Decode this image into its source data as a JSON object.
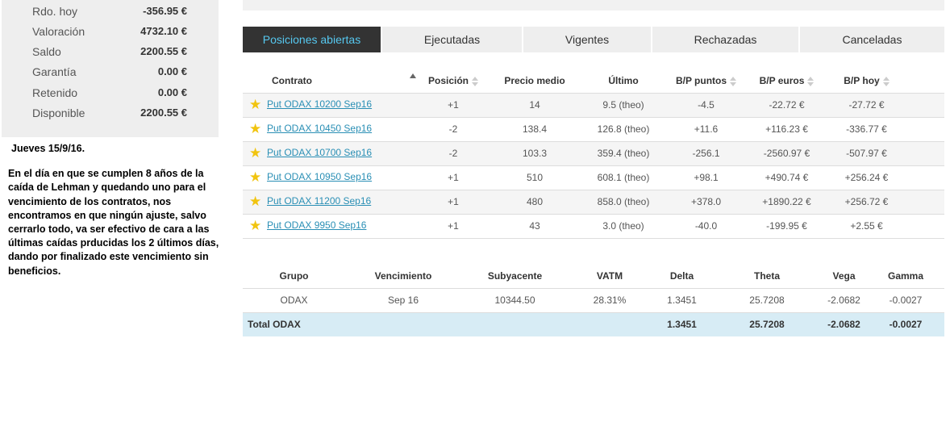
{
  "account": {
    "rows": [
      {
        "label": "Rdo. hoy",
        "value": "-356.95 €"
      },
      {
        "label": "Valoración",
        "value": "4732.10 €"
      },
      {
        "label": "Saldo",
        "value": "2200.55 €"
      },
      {
        "label": "Garantía",
        "value": "0.00 €"
      },
      {
        "label": "Retenido",
        "value": "0.00 €"
      },
      {
        "label": "Disponible",
        "value": "2200.55 €"
      }
    ]
  },
  "note": {
    "date": "Jueves 15/9/16.",
    "body": "En el día en que se cumplen 8 años de la caída de Lehman y quedando uno para el vencimiento de los contratos, nos encontramos en que ningún ajuste, salvo cerrarlo todo, va  ser efectivo de cara a las últimas caídas prducidas los 2 últimos días, dando por finalizado este vencimiento sin beneficios."
  },
  "tabs": [
    {
      "label": "Posiciones abiertas",
      "active": true
    },
    {
      "label": "Ejecutadas",
      "active": false
    },
    {
      "label": "Vigentes",
      "active": false
    },
    {
      "label": "Rechazadas",
      "active": false
    },
    {
      "label": "Canceladas",
      "active": false
    }
  ],
  "positions": {
    "headers": {
      "contract": "Contrato",
      "position": "Posición",
      "avg_price": "Precio medio",
      "last": "Último",
      "pl_points": "B/P puntos",
      "pl_euros": "B/P euros",
      "pl_today": "B/P hoy"
    },
    "rows": [
      {
        "contract": "Put ODAX 10200 Sep16",
        "position": "+1",
        "avg_price": "14",
        "last": "9.5 (theo)",
        "pl_points": "-4.5",
        "pl_euros": "-22.72 €",
        "pl_today": "-27.72 €"
      },
      {
        "contract": "Put ODAX 10450 Sep16",
        "position": "-2",
        "avg_price": "138.4",
        "last": "126.8 (theo)",
        "pl_points": "+11.6",
        "pl_euros": "+116.23 €",
        "pl_today": "-336.77 €"
      },
      {
        "contract": "Put ODAX 10700 Sep16",
        "position": "-2",
        "avg_price": "103.3",
        "last": "359.4 (theo)",
        "pl_points": "-256.1",
        "pl_euros": "-2560.97 €",
        "pl_today": "-507.97 €"
      },
      {
        "contract": "Put ODAX 10950 Sep16",
        "position": "+1",
        "avg_price": "510",
        "last": "608.1 (theo)",
        "pl_points": "+98.1",
        "pl_euros": "+490.74 €",
        "pl_today": "+256.24 €"
      },
      {
        "contract": "Put ODAX 11200 Sep16",
        "position": "+1",
        "avg_price": "480",
        "last": "858.0 (theo)",
        "pl_points": "+378.0",
        "pl_euros": "+1890.22 €",
        "pl_today": "+256.72 €"
      },
      {
        "contract": "Put ODAX 9950 Sep16",
        "position": "+1",
        "avg_price": "43",
        "last": "3.0 (theo)",
        "pl_points": "-40.0",
        "pl_euros": "-199.95 €",
        "pl_today": "+2.55 €"
      }
    ]
  },
  "groups": {
    "headers": {
      "group": "Grupo",
      "expiry": "Vencimiento",
      "underlying": "Subyacente",
      "vatm": "VATM",
      "delta": "Delta",
      "theta": "Theta",
      "vega": "Vega",
      "gamma": "Gamma"
    },
    "row": {
      "group": "ODAX",
      "expiry": "Sep 16",
      "underlying": "10344.50",
      "vatm": "28.31%",
      "delta": "1.3451",
      "theta": "25.7208",
      "vega": "-2.0682",
      "gamma": "-0.0027"
    },
    "total": {
      "label": "Total ODAX",
      "delta": "1.3451",
      "theta": "25.7208",
      "vega": "-2.0682",
      "gamma": "-0.0027"
    }
  },
  "colors": {
    "negative": "#e53935",
    "positive": "#1e9e5a",
    "link": "#2a8fb5",
    "active_tab_bg": "#333333",
    "active_tab_text": "#56c8f0"
  }
}
